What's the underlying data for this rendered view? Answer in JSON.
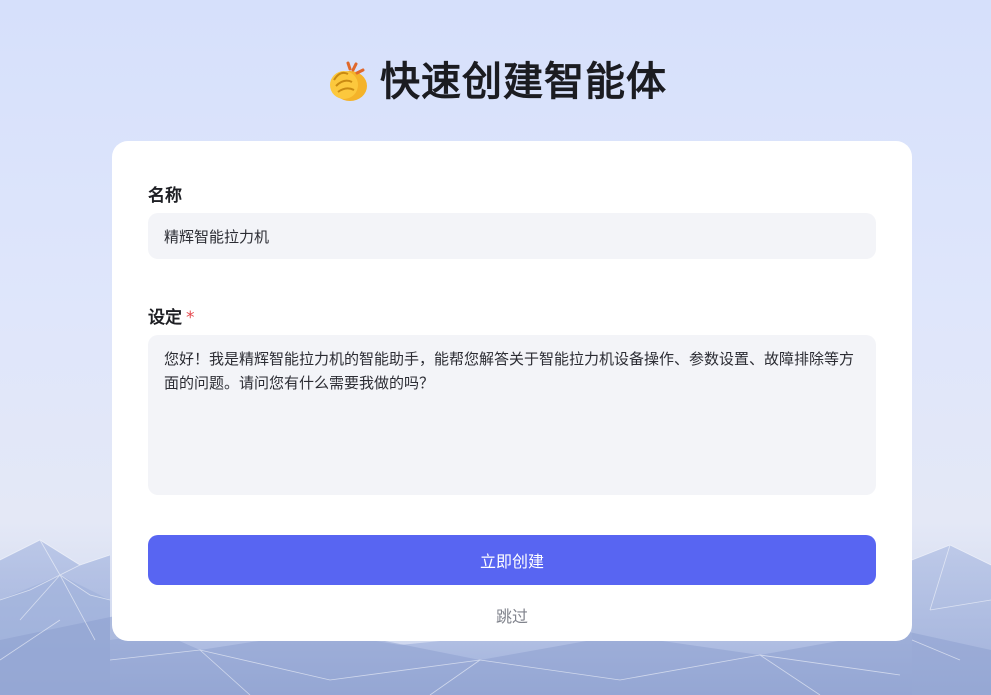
{
  "header": {
    "title": "快速创建智能体",
    "icon": "clapping-hands-icon"
  },
  "form": {
    "name_label": "名称",
    "name_value": "精辉智能拉力机",
    "setting_label": "设定",
    "setting_required_mark": "*",
    "setting_value": "您好！我是精辉智能拉力机的智能助手，能帮您解答关于智能拉力机设备操作、参数设置、故障排除等方面的问题。请问您有什么需要我做的吗？",
    "create_button_label": "立即创建",
    "skip_label": "跳过"
  },
  "colors": {
    "accent": "#5865f2",
    "required": "#e5484d",
    "input_bg": "#f3f4f8",
    "card_bg": "#ffffff"
  }
}
